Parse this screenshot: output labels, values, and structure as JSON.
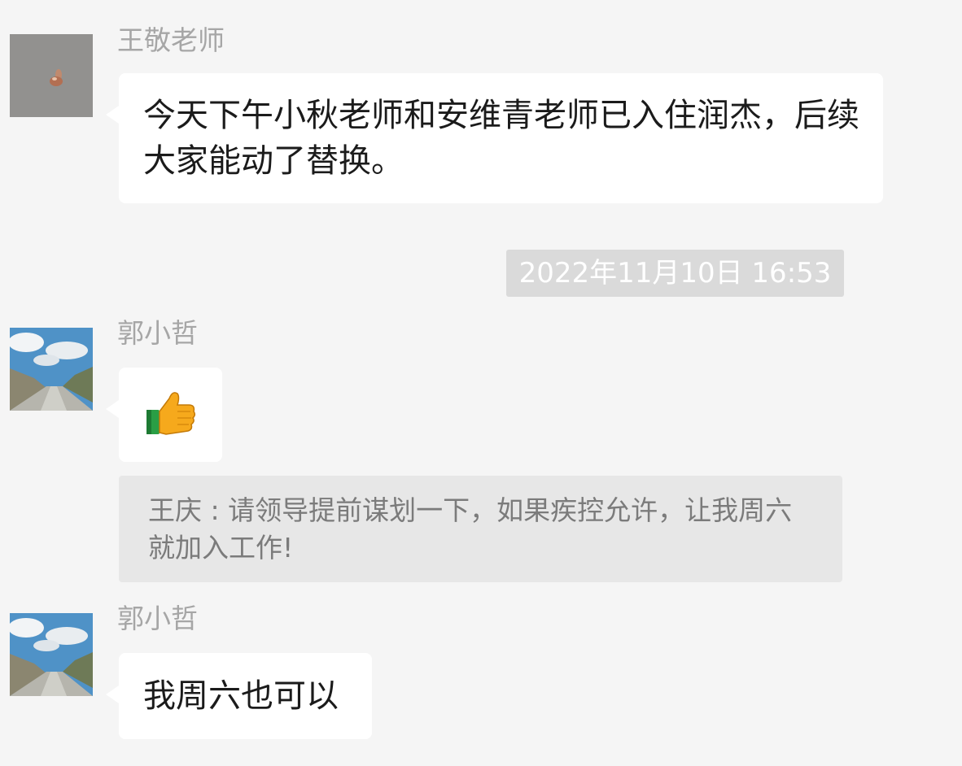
{
  "messages": [
    {
      "sender": "王敬老师",
      "avatar_icon": "close-up-avatar-icon",
      "text": "今天下午小秋老师和安维青老师已入住润杰，后续大家能动了替换。"
    },
    {
      "timestamp": "2022年11月10日 16:53"
    },
    {
      "sender": "郭小哲",
      "avatar_icon": "road-landscape-avatar-icon",
      "emoji": "👍",
      "emoji_icon": "thumbs-up-icon"
    },
    {
      "quote": "王庆 : 请领导提前谋划一下，如果疾控允许，让我周六就加入工作!"
    },
    {
      "sender": "郭小哲",
      "avatar_icon": "road-landscape-avatar-icon",
      "text": "我周六也可以"
    }
  ],
  "colors": {
    "background": "#f5f5f5",
    "bubble": "#ffffff",
    "timestamp_bg": "#dadada",
    "quote_bg": "#e7e7e7"
  }
}
